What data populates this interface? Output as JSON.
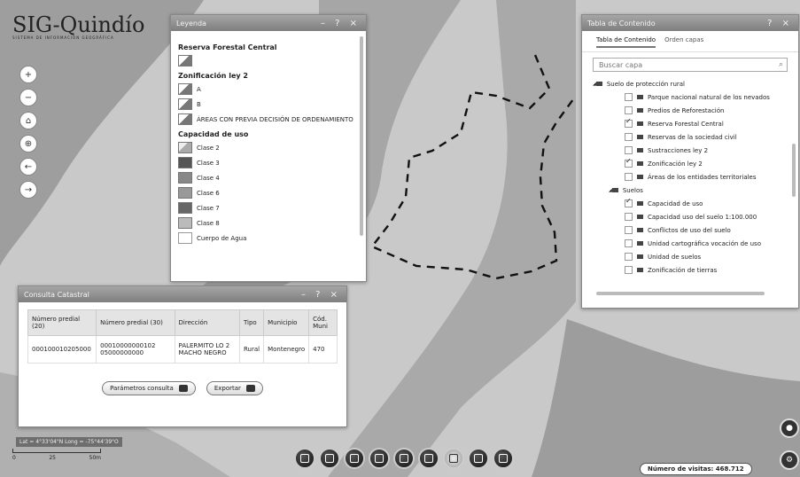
{
  "header": {
    "logo_text": "SIG-Quindío",
    "logo_subtitle": "SISTEMA DE INFORMACIÓN GEOGRÁFICA"
  },
  "left_tools": [
    {
      "icon": "zoom-in-icon",
      "glyph": "+"
    },
    {
      "icon": "zoom-out-icon",
      "glyph": "−"
    },
    {
      "icon": "home-icon",
      "glyph": "⌂"
    },
    {
      "icon": "locate-icon",
      "glyph": "⊕"
    },
    {
      "icon": "back-icon",
      "glyph": "←"
    },
    {
      "icon": "forward-icon",
      "glyph": "→"
    }
  ],
  "legend": {
    "title": "Leyenda",
    "sections": [
      {
        "heading": "Reserva Forestal Central",
        "items": [
          ""
        ]
      },
      {
        "heading": "Zonificación ley 2",
        "items": [
          "A",
          "B",
          "ÁREAS CON PREVIA DECISIÓN DE ORDENAMIENTO"
        ]
      },
      {
        "heading": "Capacidad de uso",
        "items": [
          "Clase 2",
          "Clase 3",
          "Clase 4",
          "Clase 6",
          "Clase 7",
          "Clase 8",
          "Cuerpo de Agua"
        ]
      }
    ]
  },
  "toc": {
    "title": "Tabla de Contenido",
    "tabs": [
      "Tabla de Contenido",
      "Orden capas"
    ],
    "search_placeholder": "Buscar capa",
    "tree": [
      {
        "level": 0,
        "group": true,
        "label": "Suelo de protección rural"
      },
      {
        "level": 2,
        "checked": false,
        "label": "Parque nacional natural de los nevados"
      },
      {
        "level": 2,
        "checked": false,
        "label": "Predios de Reforestación"
      },
      {
        "level": 2,
        "checked": true,
        "label": "Reserva Forestal Central"
      },
      {
        "level": 2,
        "checked": false,
        "label": "Reservas de la sociedad civil"
      },
      {
        "level": 2,
        "checked": false,
        "label": "Sustracciones ley 2"
      },
      {
        "level": 2,
        "checked": true,
        "label": "Zonificación ley 2"
      },
      {
        "level": 2,
        "checked": false,
        "label": "Áreas de los entidades territoriales"
      },
      {
        "level": 1,
        "group": true,
        "label": "Suelos"
      },
      {
        "level": 2,
        "checked": true,
        "label": "Capacidad de uso"
      },
      {
        "level": 2,
        "checked": false,
        "label": "Capacidad uso del suelo 1:100.000"
      },
      {
        "level": 2,
        "checked": false,
        "label": "Conflictos de uso del suelo"
      },
      {
        "level": 2,
        "checked": false,
        "label": "Unidad cartográfica vocación de uso"
      },
      {
        "level": 2,
        "checked": false,
        "label": "Unidad de suelos"
      },
      {
        "level": 2,
        "checked": false,
        "label": "Zonificación de tierras"
      }
    ]
  },
  "consulta": {
    "title": "Consulta Catastral",
    "columns": [
      "Número predial (20)",
      "Número predial (30)",
      "Dirección",
      "Tipo",
      "Municipio",
      "Cód. Muni"
    ],
    "rows": [
      [
        "000100010205000",
        "00010000000102 05000000000",
        "PALERMITO LO 2 MACHO NEGRO",
        "Rural",
        "Montenegro",
        "470"
      ]
    ],
    "buttons": [
      "Parámetros consulta",
      "Exportar"
    ]
  },
  "coords": "Lat = 4°33'04\"N Long = -75°44'39\"O",
  "scale": {
    "labels": [
      "0",
      "25",
      "50m"
    ]
  },
  "visits": {
    "label": "Número de visitas:",
    "value": "468.712"
  }
}
